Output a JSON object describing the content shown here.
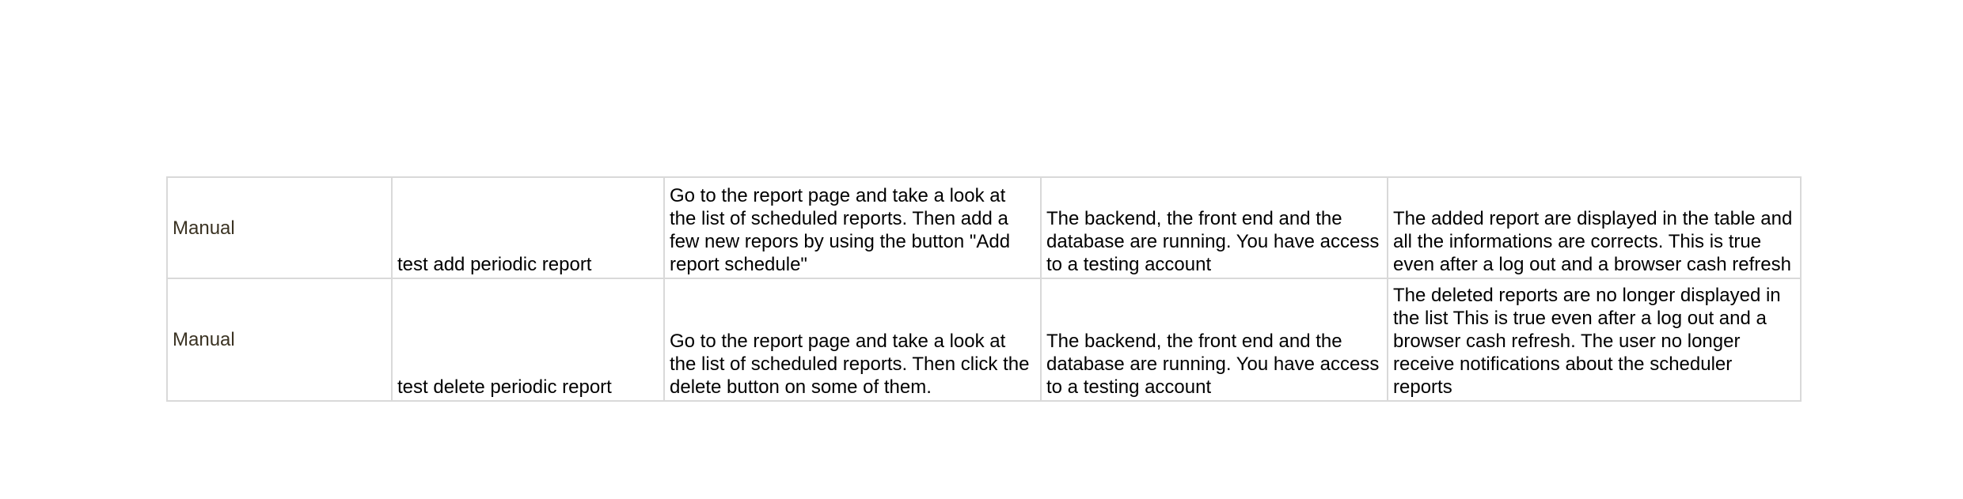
{
  "rows": [
    {
      "type": "Manual",
      "name": "test add periodic report",
      "steps": "Go to the report page and take a look at the list of scheduled reports. Then add a few new repors by using the button \"Add report schedule\"",
      "preconditions": "The backend, the front end and the database are running. You have access to a testing account",
      "expected": "The added report are displayed in the table and all the informations are corrects. This is true even after a log out and a browser cash refresh"
    },
    {
      "type": "Manual",
      "name": "test delete periodic report",
      "steps": "Go to the report page and take a look at the list of scheduled reports. Then click the delete button on some of them.",
      "preconditions": "The backend, the front end and the database are running. You have access to a testing account",
      "expected": "The deleted reports are no longer displayed in the list This is true even after a log out and a browser cash refresh. The user no longer receive notifications about the scheduler reports"
    }
  ]
}
